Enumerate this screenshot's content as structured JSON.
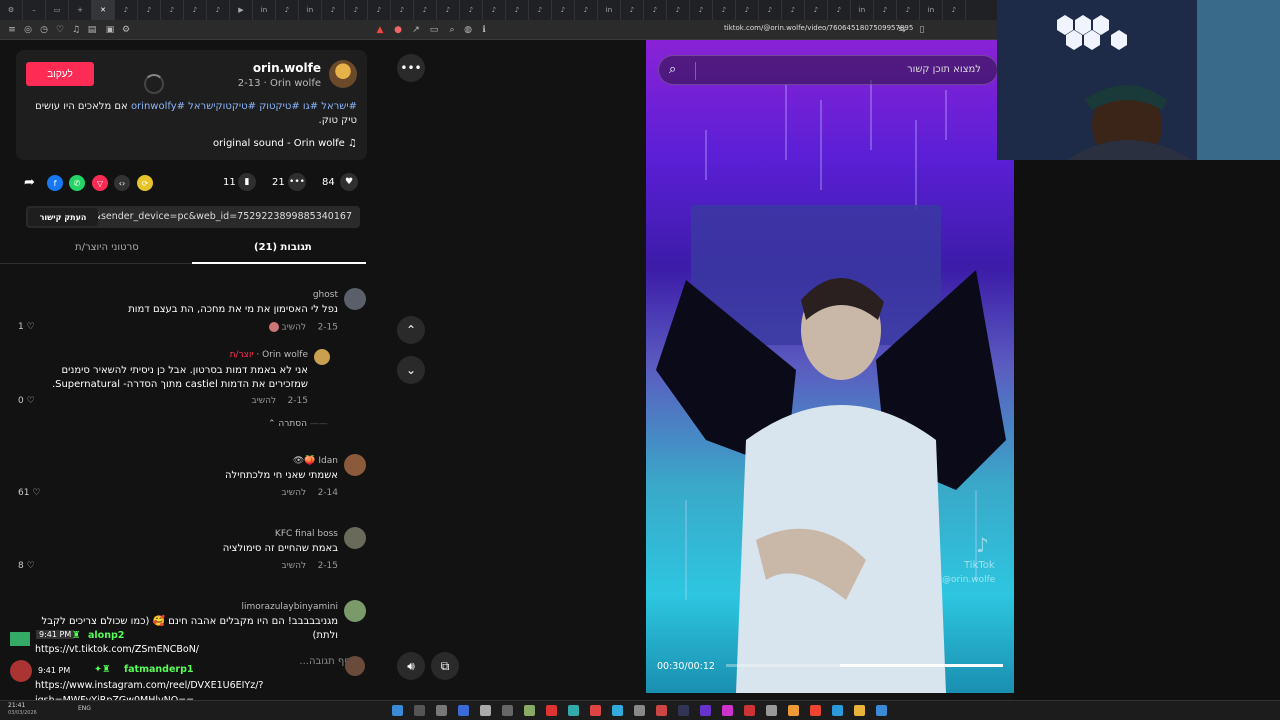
{
  "browser": {
    "url": "tiktok.com/@orin.wolfe/video/7606451807509957895"
  },
  "post": {
    "follow_label": "לעקוב",
    "username": "orin.wolfe",
    "meta": "2-13 · Orin wolfe",
    "description_tags": "#ישראל #גו #טיקטוק #טיקטוקישראל #orinwolfy",
    "description_text": "אם מלאכים היו עושים טיק טוק.",
    "sound": "original sound - Orin wolfe",
    "likes": "84",
    "comments_count": "21",
    "saves": "11",
    "share_link": "...&sender_device=pc&web_id=7529223899885340167",
    "copy_link_label": "העתק קישור"
  },
  "tabs": {
    "comments": "תגובות (21)",
    "creator_videos": "סרטוני היוצר/ת"
  },
  "comments": [
    {
      "name": "ghost",
      "text": "נפל לי האסימון את מי את מחכה, הת בעצם דמות",
      "date": "2-15",
      "reply": "להשיב",
      "likes": "1"
    },
    {
      "name": "Orin wolfe",
      "creator_badge": "יוצר/ת",
      "text": "אני לא באמת דמות בסרטון. אבל כן ניסיתי להשאיר סימנים שמזכירים את הדמות castiel מתוך הסדרה- Supernatural.",
      "date": "2-15",
      "reply": "להשיב",
      "likes": "0"
    },
    {
      "name": "Idan",
      "text": "אשמתי שאני חי מלכתחילה",
      "date": "2-14",
      "reply": "להשיב",
      "likes": "61"
    },
    {
      "name": "KFC final boss",
      "text": "באמת שהחיים זה סימולציה",
      "date": "2-15",
      "reply": "להשיב",
      "likes": "8"
    },
    {
      "name": "limorazulaybinyamini",
      "text": "מגניבבבבב! הם היו מקבלים אהבה חינם 🥰 (כמו שכולם צריכים לקבל ולתת)",
      "date": "",
      "reply": "",
      "likes": ""
    }
  ],
  "hide_replies": "הסתרה",
  "comment_input_placeholder": "הוסף תגובה...",
  "chat": {
    "time1": "9:41 PM",
    "user1": "alonp2",
    "msg1": "https://vt.tiktok.com/ZSmENCBoN/",
    "time2": "9:41 PM",
    "user2": "fatmanderp1",
    "msg2": "https://www.instagram.com/reel/DVXE1U6EIYz/?",
    "msg3": "igsh=MWFvYjRpZGw0MHlvNQ=="
  },
  "video": {
    "search_placeholder": "למצוא תוכן קשור",
    "timecode": "00:30/00:12",
    "progress_fraction": 0.41,
    "watermark": "TikTok",
    "watermark_user": "@orin.wolfe"
  },
  "taskbar": {
    "time": "21:41",
    "date": "03/03/2026",
    "lang": "ENG"
  },
  "colors": {
    "accent": "#fe2c55",
    "link": "#8ab4f8"
  }
}
